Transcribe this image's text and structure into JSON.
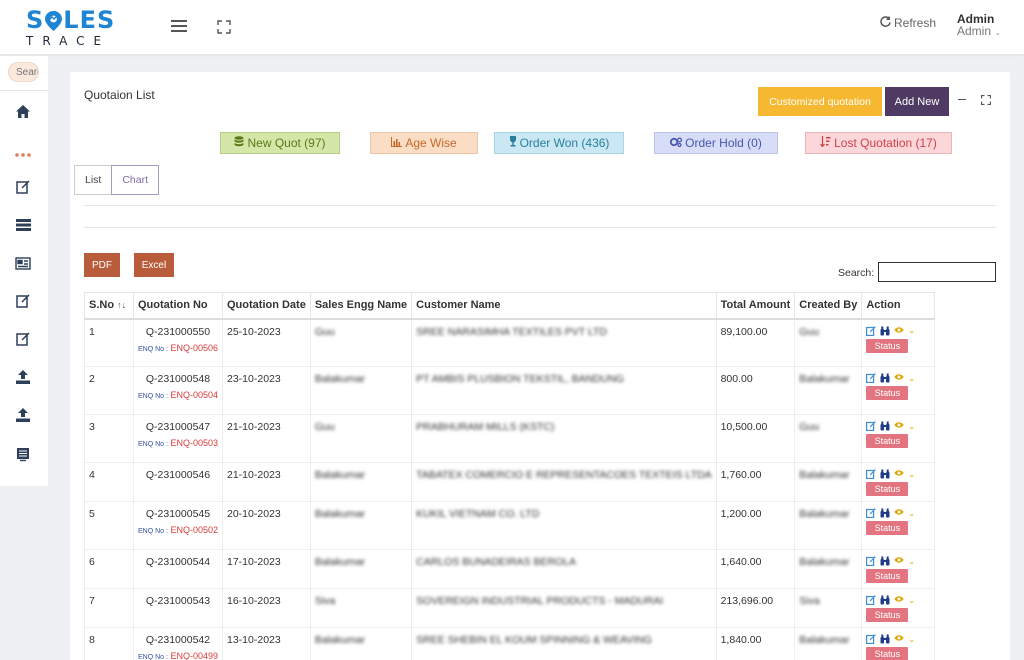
{
  "brand": {
    "top": "SALES",
    "bottom": "TRACE"
  },
  "header": {
    "refresh": "Refresh",
    "user_name": "Admin",
    "user_role": "Admin"
  },
  "sidebar": {
    "search_placeholder": "Search"
  },
  "panel": {
    "title": "Quotaion List",
    "customized_label": "Customized quotation",
    "add_new_label": "Add New"
  },
  "stats": {
    "new_quot": "New Quot (97)",
    "age_wise": "Age Wise",
    "order_won": "Order Won (436)",
    "order_hold": "Order Hold (0)",
    "lost_quotation": "Lost Quotation (17)"
  },
  "tabs": {
    "list": "List",
    "chart": "Chart"
  },
  "export": {
    "pdf": "PDF",
    "excel": "Excel"
  },
  "search": {
    "label": "Search:",
    "value": ""
  },
  "table": {
    "columns": [
      "S.No",
      "Quotation No",
      "Quotation Date",
      "Sales Engg Name",
      "Customer Name",
      "Total Amount",
      "Created By",
      "Action"
    ],
    "enq_label": "ENQ No :",
    "status_label": "Status",
    "rows": [
      {
        "sno": "1",
        "quotation_no": "Q-231000550",
        "enq": "ENQ-00506",
        "date": "25-10-2023",
        "engg": "Guu",
        "customer": "SREE NARASIMHA TEXTILES PVT LTD",
        "amount": "89,100.00",
        "created_by": "Guu"
      },
      {
        "sno": "2",
        "quotation_no": "Q-231000548",
        "enq": "ENQ-00504",
        "date": "23-10-2023",
        "engg": "Balakumar",
        "customer": "PT AMBIS PLUSBION TEKSTIL, BANDUNG",
        "amount": "800.00",
        "created_by": "Balakumar"
      },
      {
        "sno": "3",
        "quotation_no": "Q-231000547",
        "enq": "ENQ-00503",
        "date": "21-10-2023",
        "engg": "Guu",
        "customer": "PRABHURAM MILLS (KSTC)",
        "amount": "10,500.00",
        "created_by": "Guu"
      },
      {
        "sno": "4",
        "quotation_no": "Q-231000546",
        "enq": "",
        "date": "21-10-2023",
        "engg": "Balakumar",
        "customer": "TABATEX COMERCIO E REPRESENTACOES TEXTEIS LTDA",
        "amount": "1,760.00",
        "created_by": "Balakumar"
      },
      {
        "sno": "5",
        "quotation_no": "Q-231000545",
        "enq": "ENQ-00502",
        "date": "20-10-2023",
        "engg": "Balakumar",
        "customer": "KUKIL VIETNAM CO. LTD",
        "amount": "1,200.00",
        "created_by": "Balakumar"
      },
      {
        "sno": "6",
        "quotation_no": "Q-231000544",
        "enq": "",
        "date": "17-10-2023",
        "engg": "Balakumar",
        "customer": "CARLOS BUNADEIRAS BEROLA",
        "amount": "1,640.00",
        "created_by": "Balakumar"
      },
      {
        "sno": "7",
        "quotation_no": "Q-231000543",
        "enq": "",
        "date": "16-10-2023",
        "engg": "Siva",
        "customer": "SOVEREIGN INDUSTRIAL PRODUCTS - MADURAI",
        "amount": "213,696.00",
        "created_by": "Siva"
      },
      {
        "sno": "8",
        "quotation_no": "Q-231000542",
        "enq": "ENQ-00499",
        "date": "13-10-2023",
        "engg": "Balakumar",
        "customer": "SREE SHEBIN EL KOUM SPINNING & WEAVING",
        "amount": "1,840.00",
        "created_by": "Balakumar"
      }
    ]
  },
  "colors": {
    "brand_blue": "#1f84d2",
    "add_new": "#4e3a63",
    "customized": "#f5b830",
    "export": "#b85c3c",
    "status": "#e37580"
  }
}
